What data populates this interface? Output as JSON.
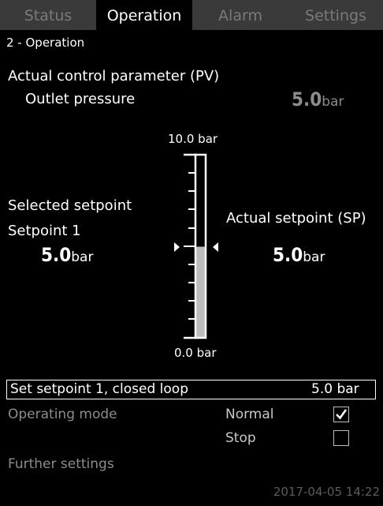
{
  "tabs": [
    "Status",
    "Operation",
    "Alarm",
    "Settings"
  ],
  "breadcrumb": "2 - Operation",
  "pv": {
    "title": "Actual control parameter (PV)",
    "name": "Outlet pressure",
    "value": "5.0",
    "unit": "bar"
  },
  "scale": {
    "top_label": "10.0 bar",
    "bottom_label": "0.0 bar",
    "fill_fraction": 0.5
  },
  "selected_setpoint": {
    "title": "Selected setpoint",
    "name": "Setpoint 1",
    "value": "5.0",
    "unit": "bar"
  },
  "actual_setpoint": {
    "title": "Actual setpoint (SP)",
    "value": "5.0",
    "unit": "bar"
  },
  "set_setpoint": {
    "label": "Set setpoint 1, closed loop",
    "value": "5.0 bar"
  },
  "operating_mode": {
    "label": "Operating mode",
    "options": [
      {
        "label": "Normal",
        "checked": true
      },
      {
        "label": "Stop",
        "checked": false
      }
    ]
  },
  "further_settings": "Further settings",
  "timestamp": "2017-04-05 14:22",
  "colors": {
    "background": "#000000",
    "tab_inactive": "#3a3a3a",
    "fill": "#bdbdbd",
    "grey_text": "#8c8c8c"
  }
}
